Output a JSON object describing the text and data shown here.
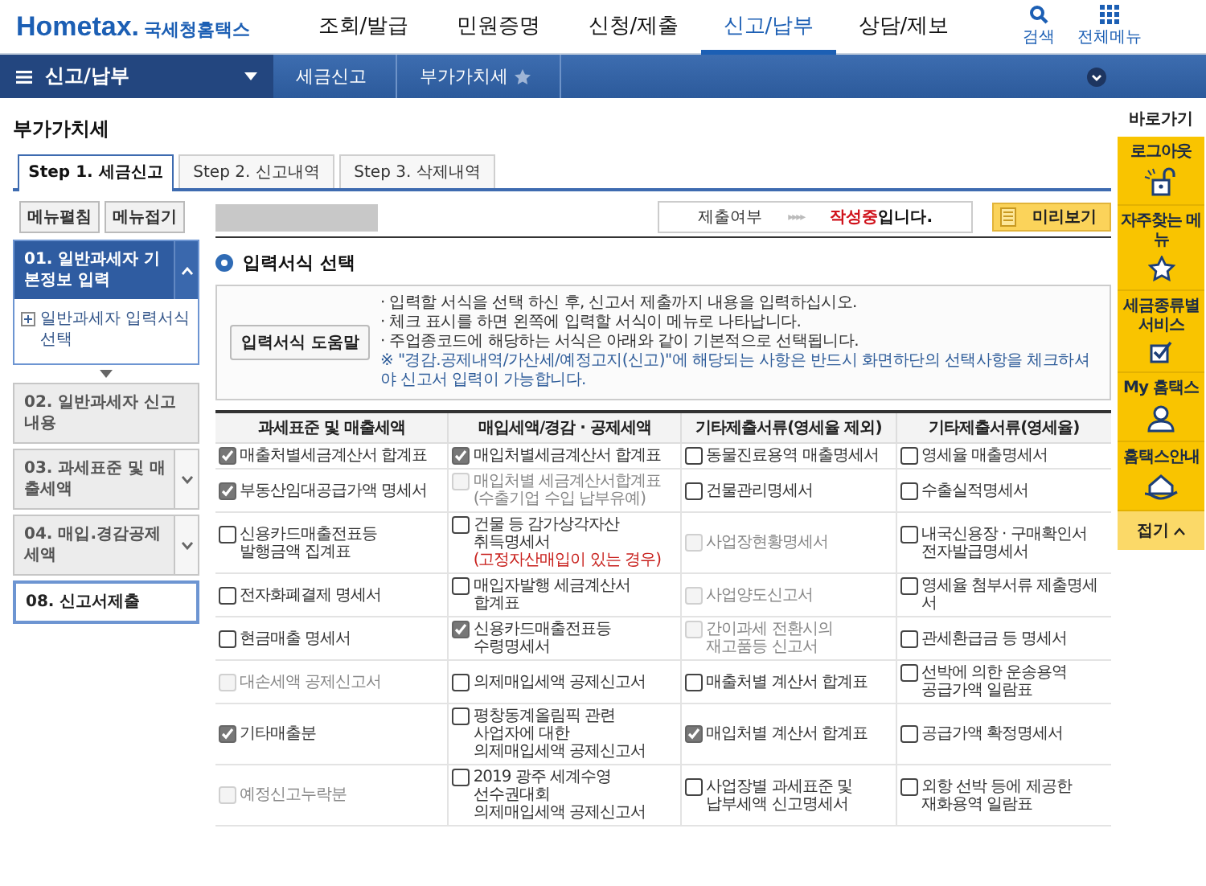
{
  "header": {
    "brand": "Hometax.",
    "brand_name": "국세청홈택스",
    "nav": [
      {
        "label": "조회/발급",
        "selected": false
      },
      {
        "label": "민원증명",
        "selected": false
      },
      {
        "label": "신청/제출",
        "selected": false
      },
      {
        "label": "신고/납부",
        "selected": true
      },
      {
        "label": "상담/제보",
        "selected": false
      }
    ],
    "tools": [
      {
        "label": "검색",
        "kind": "search"
      },
      {
        "label": "전체메뉴",
        "kind": "grid"
      }
    ]
  },
  "menu_bar": {
    "title": "신고/납부",
    "breadcrumb": [
      "세금신고",
      "부가가치세"
    ]
  },
  "page_title": "부가가치세",
  "tabs": [
    {
      "label": "Step 1. 세금신고",
      "selected": true
    },
    {
      "label": "Step 2. 신고내역",
      "selected": false
    },
    {
      "label": "Step 3. 삭제내역",
      "selected": false
    }
  ],
  "sidebar": {
    "buttons": [
      "메뉴펼침",
      "메뉴접기"
    ],
    "items": [
      {
        "kind": "group",
        "label": "01. 일반과세자 기본정보 입력",
        "selected": true,
        "expanded": true,
        "children": [
          {
            "label": "일반과세자 입력서식 선택"
          }
        ]
      },
      {
        "kind": "item",
        "label": "02. 일반과세자 신고내용",
        "selected": false
      },
      {
        "kind": "group",
        "label": "03. 과세표준 및 매출세액",
        "selected": false,
        "expanded": false
      },
      {
        "kind": "group",
        "label": "04. 매입.경감공제세액",
        "selected": false,
        "expanded": false
      },
      {
        "kind": "final",
        "label": "08. 신고서제출",
        "selected": false
      }
    ]
  },
  "status": {
    "label": "제출여부",
    "arrows": "▸▸▸▸",
    "value": "작성중",
    "suffix": "입니다."
  },
  "preview_button": "미리보기",
  "section_title": "입력서식 선택",
  "notes": [
    {
      "kind": "bullet",
      "text": "· 입력할 서식을 선택 하신 후, 신고서 제출까지 내용을 입력하십시오."
    },
    {
      "kind": "bullet",
      "text": "· 체크 표시를 하면 왼쪽에 입력할 서식이 메뉴로 나타납니다."
    },
    {
      "kind": "bullet",
      "text": "· 주업종코드에 해당하는 서식은 아래와 같이 기본적으로 선택됩니다."
    },
    {
      "kind": "remark",
      "text": "※ \"경감.공제내역/가산세/예정고지(신고)\"에 해당되는 사항은 반드시 화면하단의 선택사항을 체크하셔야 신고서 입력이 가능합니다."
    }
  ],
  "help_button": "입력서식 도움말",
  "form_table": {
    "columns": [
      "과세표준 및 매출세액",
      "매입세액/경감 · 공제세액",
      "기타제출서류(영세율 제외)",
      "기타제출서류(영세율)"
    ],
    "rows": [
      [
        {
          "label": "매출처별세금계산서 합계표",
          "checked": true,
          "disabled": false
        },
        {
          "label": "매입처별세금계산서 합계표",
          "checked": true,
          "disabled": false
        },
        {
          "label": "동물진료용역 매출명세서",
          "checked": false,
          "disabled": false
        },
        {
          "label": "영세율 매출명세서",
          "checked": false,
          "disabled": false
        }
      ],
      [
        {
          "label": "부동산임대공급가액 명세서",
          "checked": true,
          "disabled": false
        },
        {
          "label": "매입처별 세금계산서합계표\n(수출기업 수입 납부유예)",
          "checked": false,
          "disabled": true
        },
        {
          "label": "건물관리명세서",
          "checked": false,
          "disabled": false
        },
        {
          "label": "수출실적명세서",
          "checked": false,
          "disabled": false
        }
      ],
      [
        {
          "label": "신용카드매출전표등\n발행금액 집계표",
          "checked": false,
          "disabled": false
        },
        {
          "label": "건물 등 감가상각자산\n취득명세서",
          "note": "(고정자산매입이 있는 경우)",
          "checked": false,
          "disabled": false
        },
        {
          "label": "사업장현황명세서",
          "checked": false,
          "disabled": true
        },
        {
          "label": "내국신용장 · 구매확인서\n전자발급명세서",
          "checked": false,
          "disabled": false
        }
      ],
      [
        {
          "label": "전자화폐결제 명세서",
          "checked": false,
          "disabled": false
        },
        {
          "label": "매입자발행 세금계산서\n합계표",
          "checked": false,
          "disabled": false
        },
        {
          "label": "사업양도신고서",
          "checked": false,
          "disabled": true
        },
        {
          "label": "영세율 첨부서류 제출명세서",
          "checked": false,
          "disabled": false
        }
      ],
      [
        {
          "label": "현금매출 명세서",
          "checked": false,
          "disabled": false
        },
        {
          "label": "신용카드매출전표등\n수령명세서",
          "checked": true,
          "disabled": false
        },
        {
          "label": "간이과세 전환시의\n재고품등 신고서",
          "checked": false,
          "disabled": true
        },
        {
          "label": "관세환급금 등 명세서",
          "checked": false,
          "disabled": false
        }
      ],
      [
        {
          "label": "대손세액 공제신고서",
          "checked": false,
          "disabled": true
        },
        {
          "label": "의제매입세액 공제신고서",
          "checked": false,
          "disabled": false
        },
        {
          "label": "매출처별 계산서 합계표",
          "checked": false,
          "disabled": false
        },
        {
          "label": "선박에 의한 운송용역\n공급가액 일람표",
          "checked": false,
          "disabled": false
        }
      ],
      [
        {
          "label": "기타매출분",
          "checked": true,
          "disabled": false
        },
        {
          "label": "평창동계올림픽 관련\n사업자에 대한\n의제매입세액 공제신고서",
          "checked": false,
          "disabled": false
        },
        {
          "label": "매입처별 계산서 합계표",
          "checked": true,
          "disabled": false
        },
        {
          "label": "공급가액 확정명세서",
          "checked": false,
          "disabled": false
        }
      ],
      [
        {
          "label": "예정신고누락분",
          "checked": false,
          "disabled": true
        },
        {
          "label": "2019 광주 세계수영\n선수권대회\n의제매입세액 공제신고서",
          "checked": false,
          "disabled": false
        },
        {
          "label": "사업장별 과세표준 및\n납부세액 신고명세서",
          "checked": false,
          "disabled": false
        },
        {
          "label": "외항 선박 등에 제공한\n재화용역 일람표",
          "checked": false,
          "disabled": false
        }
      ]
    ]
  },
  "quick_bar": {
    "title": "바로가기",
    "items": [
      {
        "kind": "logout",
        "label": "로그아웃"
      },
      {
        "kind": "star",
        "label": "자주찾는 메뉴"
      },
      {
        "kind": "check",
        "label": "세금종류별 서비스"
      },
      {
        "kind": "person",
        "label": "My 홈택스"
      },
      {
        "kind": "house",
        "label": "홈택스안내"
      }
    ],
    "collapse": "접기"
  }
}
